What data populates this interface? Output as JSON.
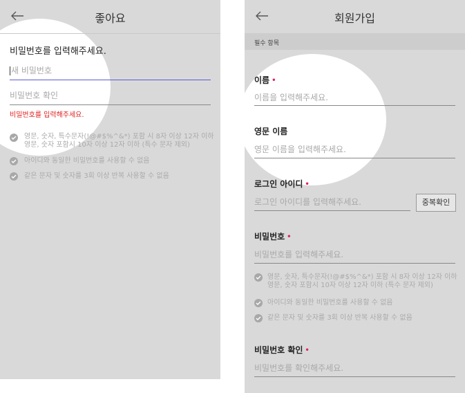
{
  "left": {
    "title": "좋아요",
    "prompt": "비밀번호를 입력해주세요.",
    "new_password_placeholder": "새 비밀번호",
    "confirm_placeholder": "비밀번호 확인",
    "error": "비밀번호를 입력해주세요.",
    "rules": [
      {
        "line1": "영문, 숫자, 특수문자(!@#$%^&*) 포함 시 8자 이상 12자 이하",
        "line2": "영문, 숫자 포함시 10자 이상 12자 이하 (특수 문자 제외)"
      },
      {
        "line1": "아이디와 동일한 비밀번호를 사용할 수 없음"
      },
      {
        "line1": "같은 문자 및 숫자를 3회 이상 반복 사용할 수 없음"
      }
    ]
  },
  "right": {
    "title": "회원가입",
    "section": "필수 항목",
    "name": {
      "label": "이름",
      "placeholder": "이름을 입력해주세요."
    },
    "eng_name": {
      "label": "영문 이름",
      "placeholder": "영문 이름을 입력해주세요."
    },
    "login_id": {
      "label": "로그인 아이디",
      "placeholder": "로그인 아이디를 입력해주세요.",
      "button": "중복확인"
    },
    "password": {
      "label": "비밀번호",
      "placeholder": "비밀번호를 입력해주세요."
    },
    "rules": [
      {
        "line1": "영문, 숫자, 특수문자(!@#$%^&*) 포함 시 8자 이상 12자 이하",
        "line2": "영문, 숫자 포함시 10자 이상 12자 이하 (특수 문자 제외)"
      },
      {
        "line1": "아이디와 동일한 비밀번호를 사용할 수 없음"
      },
      {
        "line1": "같은 문자 및 숫자를 3회 이상 반복 사용할 수 없음"
      }
    ],
    "password_confirm": {
      "label": "비밀번호 확인",
      "placeholder": "비밀번호를 확인해주세요."
    },
    "required_mark": "•"
  },
  "colors": {
    "required": "#e0245e",
    "error": "#e02020",
    "accent_line": "#5b5bd6"
  },
  "icons": {
    "back": "arrow-left-icon",
    "check": "check-circle-icon"
  }
}
